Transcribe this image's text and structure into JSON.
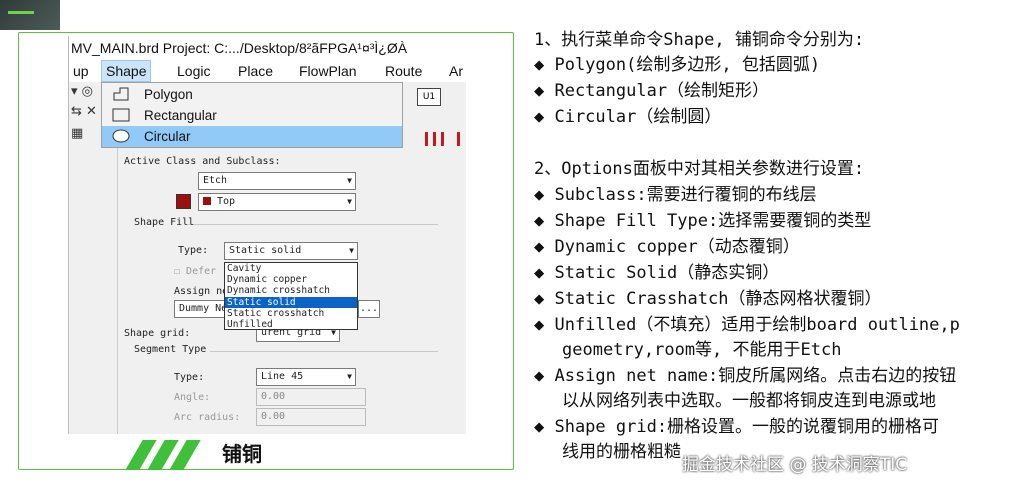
{
  "window": {
    "title": "MV_MAIN.brd  Project: C:.../Desktop/8²ãFPGA¹¤³Ì¿ØÀ"
  },
  "menubar": {
    "items": [
      "up",
      "Shape",
      "Logic",
      "Place",
      "FlowPlan",
      "Route",
      "Ar"
    ]
  },
  "shape_menu": {
    "items": [
      "Polygon",
      "Rectangular",
      "Circular"
    ]
  },
  "toolbar": {
    "u_label": "U1"
  },
  "options": {
    "active_class_label": "Active Class and Subclass:",
    "class_value": "Etch",
    "subclass_value": "Top",
    "shape_fill_label": "Shape Fill",
    "type_label": "Type:",
    "type_value": "Static solid",
    "defer_label": "Defer",
    "assign_net_label": "Assign ne",
    "net_value": "Dummy Ne",
    "net_button": "...",
    "shape_grid_label": "Shape grid:",
    "shape_grid_value": "urent grid",
    "segment_type_label": "Segment Type",
    "seg_type_label": "Type:",
    "seg_type_value": "Line 45",
    "angle_label": "Angle:",
    "angle_value": "0.00",
    "arc_radius_label": "Arc radius:",
    "arc_radius_value": "0.00",
    "fill_options": [
      "Cavity",
      "Dynamic copper",
      "Dynamic crosshatch",
      "Static solid",
      "Static crosshatch",
      "Unfilled"
    ]
  },
  "caption": "铺铜",
  "notes": {
    "lines": [
      "1、执行菜单命令Shape, 铺铜命令分别为:",
      "◆ Polygon(绘制多边形, 包括圆弧)",
      "◆ Rectangular（绘制矩形）",
      "◆ Circular（绘制圆）",
      "2、Options面板中对其相关参数进行设置:",
      "◆ Subclass:需要进行覆铜的布线层",
      "◆ Shape Fill Type:选择需要覆铜的类型",
      "◆ Dynamic copper（动态覆铜）",
      "◆ Static Solid（静态实铜）",
      "◆ Static Crasshatch（静态网格状覆铜）",
      "◆ Unfilled（不填充）适用于绘制board outline,p",
      "geometry,room等, 不能用于Etch",
      "◆ Assign net name:铜皮所属网络。点击右边的按钮",
      "以从网络列表中选取。一般都将铜皮连到电源或地",
      "◆ Shape grid:栅格设置。一般的说覆铜用的栅格可",
      "线用的栅格粗糙"
    ]
  },
  "watermark": "掘金技术社区 @ 技术洞察TIC"
}
